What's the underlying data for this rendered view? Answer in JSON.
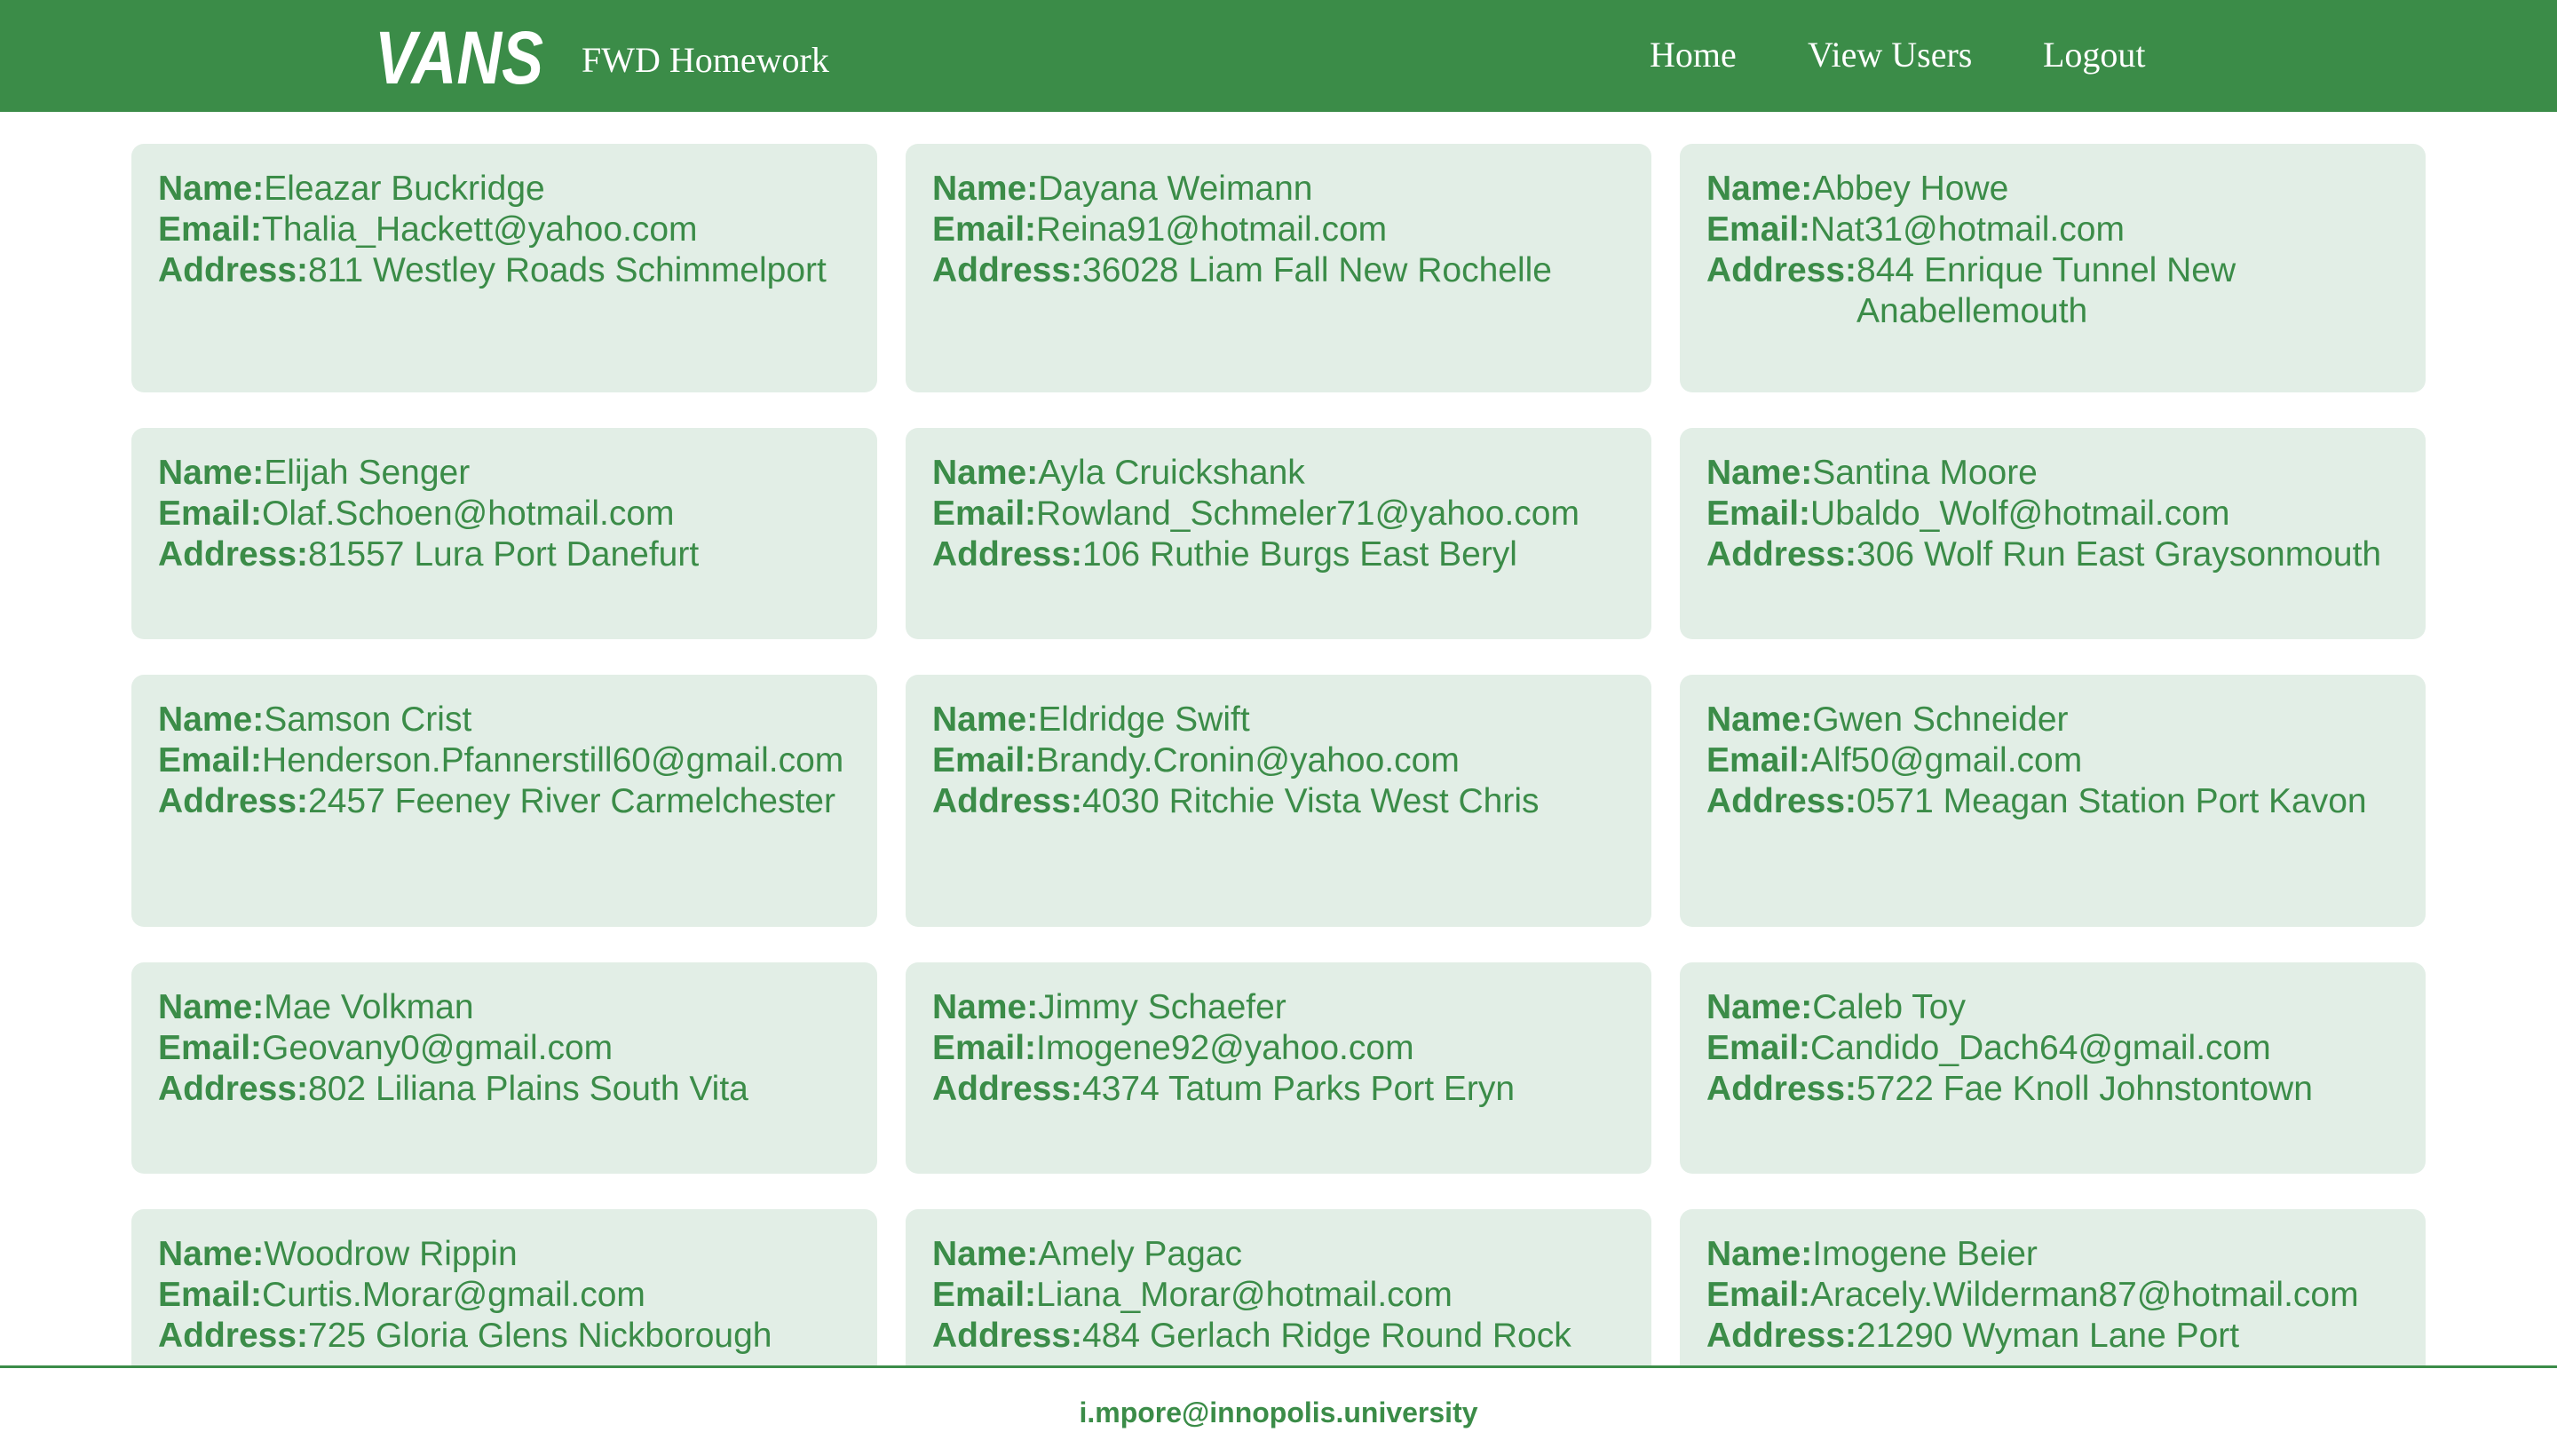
{
  "header": {
    "logo_text": "VANS",
    "title": "FWD Homework",
    "nav": [
      "Home",
      "View Users",
      "Logout"
    ]
  },
  "labels": {
    "name": "Name:",
    "email": "Email:",
    "address": "Address:"
  },
  "users": [
    {
      "name": "Eleazar Buckridge",
      "email": "Thalia_Hackett@yahoo.com",
      "address": "811 Westley Roads Schimmelport"
    },
    {
      "name": "Dayana Weimann",
      "email": "Reina91@hotmail.com",
      "address": "36028 Liam Fall New Rochelle"
    },
    {
      "name": "Abbey Howe",
      "email": "Nat31@hotmail.com",
      "address": "844 Enrique Tunnel New Anabellemouth"
    },
    {
      "name": "Elijah Senger",
      "email": "Olaf.Schoen@hotmail.com",
      "address": "81557 Lura Port Danefurt"
    },
    {
      "name": "Ayla Cruickshank",
      "email": "Rowland_Schmeler71@yahoo.com",
      "address": "106 Ruthie Burgs East Beryl"
    },
    {
      "name": "Santina Moore",
      "email": "Ubaldo_Wolf@hotmail.com",
      "address": "306 Wolf Run East Graysonmouth"
    },
    {
      "name": "Samson Crist",
      "email": "Henderson.Pfannerstill60@gmail.com",
      "address": "2457 Feeney River Carmelchester"
    },
    {
      "name": "Eldridge Swift",
      "email": "Brandy.Cronin@yahoo.com",
      "address": "4030 Ritchie Vista West Chris"
    },
    {
      "name": "Gwen Schneider",
      "email": "Alf50@gmail.com",
      "address": "0571 Meagan Station Port Kavon"
    },
    {
      "name": "Mae Volkman",
      "email": "Geovany0@gmail.com",
      "address": "802 Liliana Plains South Vita"
    },
    {
      "name": "Jimmy Schaefer",
      "email": "Imogene92@yahoo.com",
      "address": "4374 Tatum Parks Port Eryn"
    },
    {
      "name": "Caleb Toy",
      "email": "Candido_Dach64@gmail.com",
      "address": "5722 Fae Knoll Johnstontown"
    },
    {
      "name": "Woodrow Rippin",
      "email": "Curtis.Morar@gmail.com",
      "address": "725 Gloria Glens Nickborough"
    },
    {
      "name": "Amely Pagac",
      "email": "Liana_Morar@hotmail.com",
      "address": "484 Gerlach Ridge Round Rock"
    },
    {
      "name": "Imogene Beier",
      "email": "Aracely.Wilderman87@hotmail.com",
      "address": "21290 Wyman Lane Port"
    }
  ],
  "footer": {
    "email": "i.mpore@innopolis.university"
  },
  "colors": {
    "brand_green": "#3b8c48",
    "card_background": "#e2eee6",
    "header_text": "#ffffff"
  }
}
